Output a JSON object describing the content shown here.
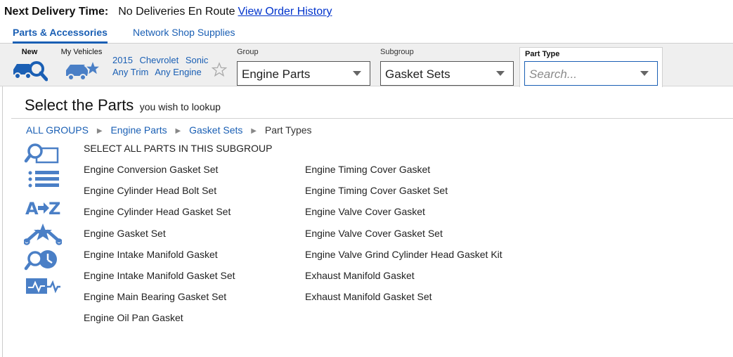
{
  "header": {
    "delivery_label": "Next Delivery Time:",
    "delivery_value": "No Deliveries En Route",
    "order_history_link": "View Order History"
  },
  "tabs": [
    {
      "label": "Parts & Accessories",
      "active": true
    },
    {
      "label": "Network Shop Supplies",
      "active": false
    }
  ],
  "toolbar": {
    "new_label": "New",
    "my_vehicles_label": "My Vehicles",
    "vehicle": {
      "year": "2015",
      "make": "Chevrolet",
      "model": "Sonic",
      "trim": "Any Trim",
      "engine": "Any Engine"
    },
    "group": {
      "label": "Group",
      "value": "Engine Parts"
    },
    "subgroup": {
      "label": "Subgroup",
      "value": "Gasket Sets"
    },
    "part_type": {
      "label": "Part Type",
      "placeholder": "Search..."
    }
  },
  "main": {
    "title": "Select the Parts",
    "subtitle": "you wish to lookup",
    "breadcrumbs": [
      "ALL GROUPS",
      "Engine Parts",
      "Gasket Sets",
      "Part Types"
    ],
    "select_all": "SELECT ALL PARTS IN THIS SUBGROUP",
    "parts_col1": [
      "Engine Conversion Gasket Set",
      "Engine Cylinder Head Bolt Set",
      "Engine Cylinder Head Gasket Set",
      "Engine Gasket Set",
      "Engine Intake Manifold Gasket",
      "Engine Intake Manifold Gasket Set",
      "Engine Main Bearing Gasket Set",
      "Engine Oil Pan Gasket"
    ],
    "parts_col2": [
      "Engine Timing Cover Gasket",
      "Engine Timing Cover Gasket Set",
      "Engine Valve Cover Gasket",
      "Engine Valve Cover Gasket Set",
      "Engine Valve Grind Cylinder Head Gasket Kit",
      "Exhaust Manifold Gasket",
      "Exhaust Manifold Gasket Set"
    ],
    "side_icons": [
      "search-catalog-icon",
      "list-view-icon",
      "a-to-z-icon",
      "tools-star-icon",
      "search-history-icon",
      "diagnostic-icon"
    ]
  },
  "colors": {
    "accent": "#1a5fb4",
    "link": "#0033cc",
    "icon": "#4a7fc6"
  }
}
